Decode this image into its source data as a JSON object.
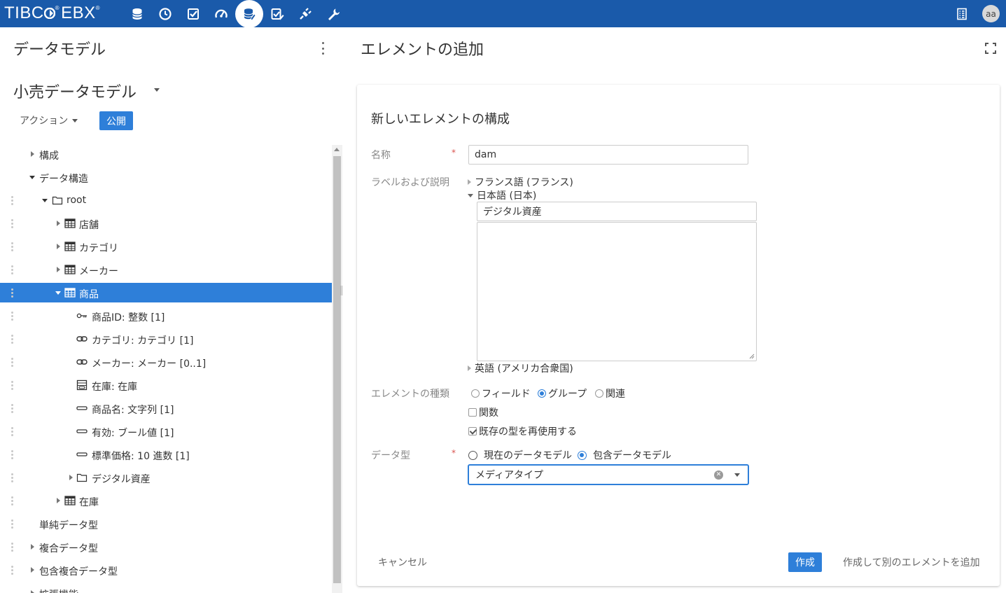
{
  "header": {
    "logo": "TIBC",
    "logo_rest": "EBX",
    "logo_mark": "®",
    "nav_icons": [
      "database-icon",
      "clock-icon",
      "tasks-icon",
      "dashboard-icon",
      "data-model-icon",
      "workflow-icon",
      "plugin-icon",
      "wrench-icon"
    ],
    "active_icon": "data-model-icon",
    "user_initials": "aa"
  },
  "left": {
    "title": "データモデル",
    "model_name": "小売データモデル",
    "action_label": "アクション",
    "publish_label": "公開",
    "tree": [
      {
        "label": "構成",
        "icon": "",
        "expander": "right",
        "depth": 0,
        "drag": false
      },
      {
        "label": "データ構造",
        "icon": "",
        "expander": "down",
        "depth": 0,
        "drag": false
      },
      {
        "label": "root",
        "icon": "folder-icon",
        "expander": "down",
        "depth": 1,
        "drag": true
      },
      {
        "label": "店舗",
        "icon": "table-icon",
        "expander": "right",
        "depth": 2,
        "drag": true
      },
      {
        "label": "カテゴリ",
        "icon": "table-icon",
        "expander": "right",
        "depth": 2,
        "drag": true
      },
      {
        "label": "メーカー",
        "icon": "table-icon",
        "expander": "right",
        "depth": 2,
        "drag": true
      },
      {
        "label": "商品",
        "icon": "table-icon",
        "expander": "down",
        "depth": 2,
        "drag": true,
        "selected": true
      },
      {
        "label": "商品ID: 整数  [1]",
        "icon": "key-icon",
        "expander": "",
        "depth": 3,
        "drag": true
      },
      {
        "label": "カテゴリ: カテゴリ  [1]",
        "icon": "link-icon",
        "expander": "",
        "depth": 3,
        "drag": true
      },
      {
        "label": "メーカー: メーカー  [0..1]",
        "icon": "link-icon",
        "expander": "",
        "depth": 3,
        "drag": true
      },
      {
        "label": "在庫: 在庫",
        "icon": "association-icon",
        "expander": "",
        "depth": 3,
        "drag": true
      },
      {
        "label": "商品名: 文字列  [1]",
        "icon": "field-icon",
        "expander": "",
        "depth": 3,
        "drag": true
      },
      {
        "label": "有効: ブール値  [1]",
        "icon": "field-icon",
        "expander": "",
        "depth": 3,
        "drag": true
      },
      {
        "label": "標準価格: 10 進数  [1]",
        "icon": "field-icon",
        "expander": "",
        "depth": 3,
        "drag": true
      },
      {
        "label": "デジタル資産",
        "icon": "folder-icon",
        "expander": "right",
        "depth": 3,
        "drag": true
      },
      {
        "label": "在庫",
        "icon": "table-icon",
        "expander": "right",
        "depth": 2,
        "drag": true
      },
      {
        "label": "単純データ型",
        "icon": "",
        "expander": "",
        "depth": 0,
        "drag": true
      },
      {
        "label": "複合データ型",
        "icon": "",
        "expander": "right",
        "depth": 0,
        "drag": true
      },
      {
        "label": "包含複合データ型",
        "icon": "",
        "expander": "right",
        "depth": 0,
        "drag": true
      },
      {
        "label": "拡張機能",
        "icon": "",
        "expander": "right",
        "depth": 0,
        "drag": false
      }
    ]
  },
  "right": {
    "title": "エレメントの追加",
    "form_title": "新しいエレメントの構成",
    "name_label": "名称",
    "name_value": "dam",
    "required_mark": "*",
    "labels_label": "ラベルおよび説明",
    "lang_french": "フランス語 (フランス)",
    "lang_japanese": "日本語 (日本)",
    "jp_label_value": "デジタル資産",
    "jp_description_value": "",
    "lang_english": "英語 (アメリカ合衆国)",
    "element_type_label": "エレメントの種類",
    "element_types": [
      "フィールド",
      "グループ",
      "関連"
    ],
    "element_type_selected": "グループ",
    "function_label": "関数",
    "function_checked": false,
    "reuse_label": "既存の型を再使用する",
    "reuse_checked": true,
    "data_type_label": "データ型",
    "data_type_options": [
      "現在のデータモデル",
      "包含データモデル"
    ],
    "data_type_selected": "包含データモデル",
    "data_type_value": "メディアタイプ",
    "cancel_label": "キャンセル",
    "create_label": "作成",
    "create_add_label": "作成して別のエレメントを追加"
  },
  "colors": {
    "header_bg": "#1a5aaa",
    "accent": "#2e7fd9",
    "required": "#d9534f"
  }
}
